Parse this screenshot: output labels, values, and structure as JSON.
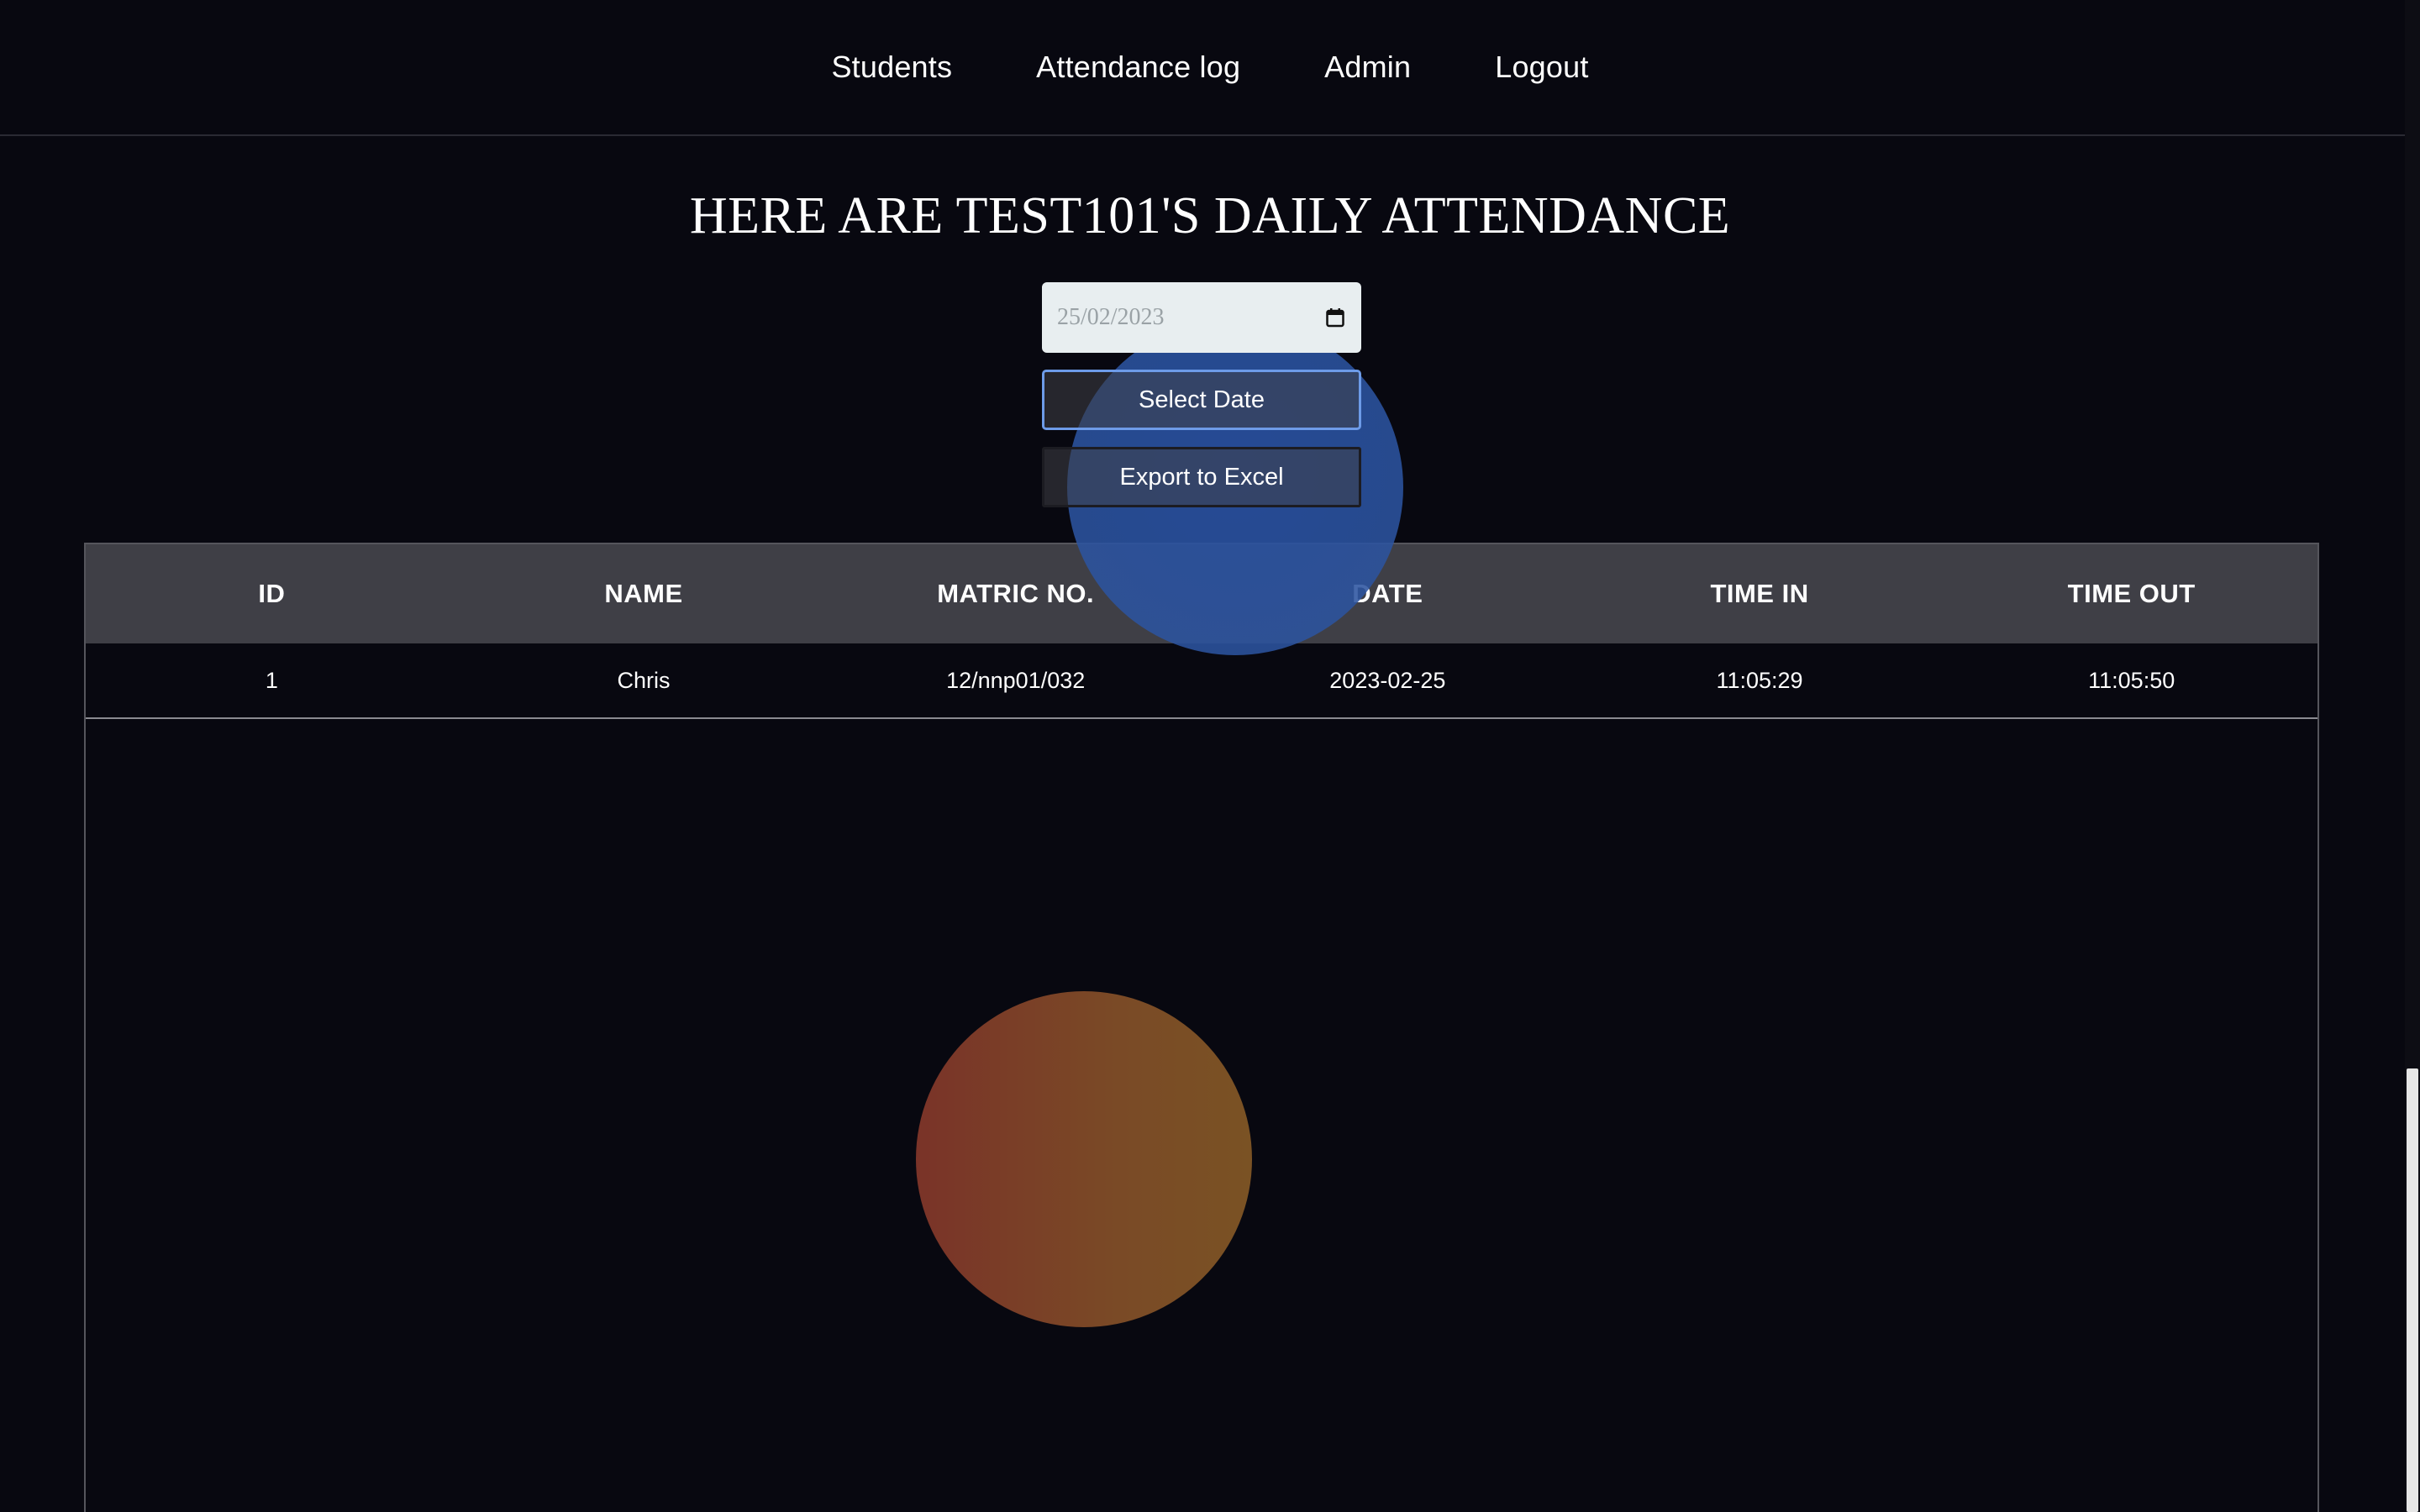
{
  "nav": {
    "items": [
      {
        "label": "Students"
      },
      {
        "label": "Attendance log"
      },
      {
        "label": "Admin"
      },
      {
        "label": "Logout"
      }
    ]
  },
  "page": {
    "title": "HERE ARE TEST101'S DAILY ATTENDANCE"
  },
  "controls": {
    "date_value": "25/02/2023",
    "calendar_icon": "calendar-icon",
    "select_label": "Select Date",
    "export_label": "Export to Excel",
    "select_border_color": "#6d9be8"
  },
  "table": {
    "headers": [
      "ID",
      "NAME",
      "MATRIC NO.",
      "DATE",
      "TIME IN",
      "TIME OUT"
    ],
    "rows": [
      [
        "1",
        "Chris",
        "12/nnp01/032",
        "2023-02-25",
        "11:05:29",
        "11:05:50"
      ]
    ]
  },
  "colors": {
    "background": "#080810",
    "header_bg": "#3f3f46",
    "blob_blue": "#2d55a0",
    "blob_orange": "#7a4a26"
  }
}
